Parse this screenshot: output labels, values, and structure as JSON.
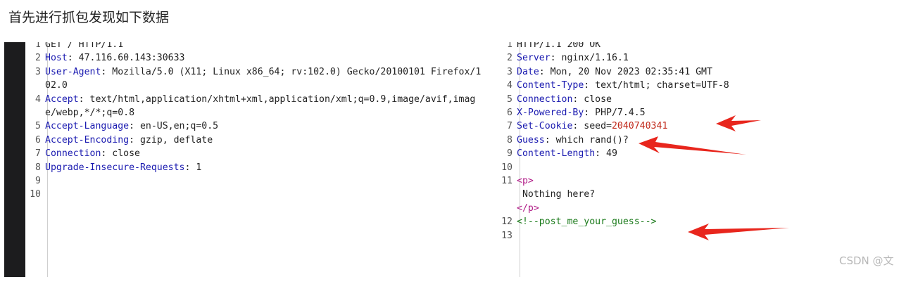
{
  "heading": "首先进行抓包发现如下数据",
  "request": [
    {
      "n": "1",
      "key": "",
      "val": "GET / HTTP/1.1"
    },
    {
      "n": "2",
      "key": "Host",
      "val": ": 47.116.60.143:30633"
    },
    {
      "n": "3",
      "key": "User-Agent",
      "val": ": Mozilla/5.0 (X11; Linux x86_64; rv:102.0) Gecko/20100101 Firefox/102.0"
    },
    {
      "n": "4",
      "key": "Accept",
      "val": ": text/html,application/xhtml+xml,application/xml;q=0.9,image/avif,image/webp,*/*;q=0.8"
    },
    {
      "n": "5",
      "key": "Accept-Language",
      "val": ": en-US,en;q=0.5"
    },
    {
      "n": "6",
      "key": "Accept-Encoding",
      "val": ": gzip, deflate"
    },
    {
      "n": "7",
      "key": "Connection",
      "val": ": close"
    },
    {
      "n": "8",
      "key": "Upgrade-Insecure-Requests",
      "val": ": 1"
    },
    {
      "n": "9",
      "key": "",
      "val": ""
    },
    {
      "n": "10",
      "key": "",
      "val": ""
    }
  ],
  "response": [
    {
      "n": "1",
      "key": "",
      "val": "HTTP/1.1 200 OK"
    },
    {
      "n": "2",
      "key": "Server",
      "val": ": nginx/1.16.1"
    },
    {
      "n": "3",
      "key": "Date",
      "val": ": Mon, 20 Nov 2023 02:35:41 GMT"
    },
    {
      "n": "4",
      "key": "Content-Type",
      "val": ": text/html; charset=UTF-8"
    },
    {
      "n": "5",
      "key": "Connection",
      "val": ": close"
    },
    {
      "n": "6",
      "key": "X-Powered-By",
      "val": ": PHP/7.4.5"
    },
    {
      "n": "7",
      "key": "Set-Cookie",
      "val": ": seed=",
      "red": "2040740341"
    },
    {
      "n": "8",
      "key": "Guess",
      "val": ": which rand()?"
    },
    {
      "n": "9",
      "key": "Content-Length",
      "val": ": 49"
    },
    {
      "n": "10",
      "key": "",
      "val": ""
    },
    {
      "n": "11",
      "key": "",
      "val": "",
      "tag": "<p>"
    },
    {
      "n": "",
      "key": "",
      "val": " Nothing here?"
    },
    {
      "n": "",
      "key": "",
      "val": "",
      "tag": "</p>"
    },
    {
      "n": "12",
      "key": "",
      "val": "",
      "cmt": "<!--post_me_your_guess-->"
    },
    {
      "n": "13",
      "key": "",
      "val": ""
    }
  ],
  "watermark": "CSDN @文",
  "colors": {
    "arrow": "#e8261d",
    "key": "#1a1ab0",
    "cookie": "#c0281a"
  }
}
